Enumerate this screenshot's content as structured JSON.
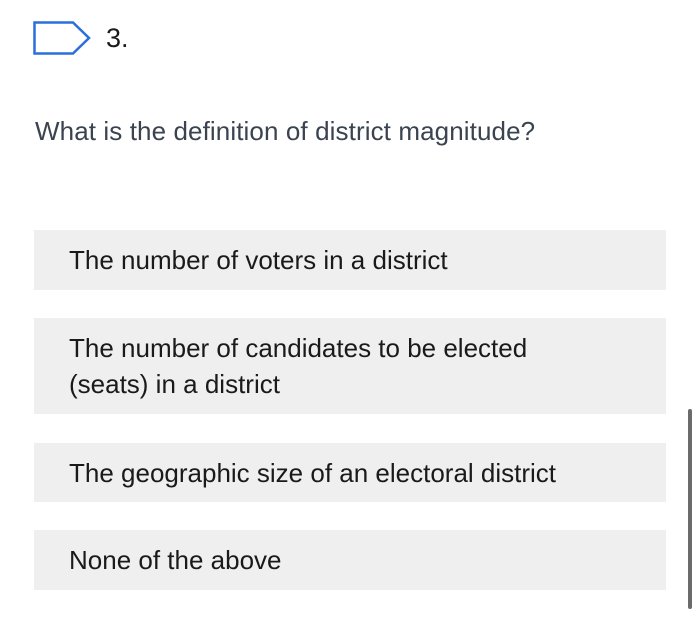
{
  "question": {
    "number": "3.",
    "text": "What is the definition of district magnitude?"
  },
  "options": [
    {
      "label": "The number of voters in a district"
    },
    {
      "label": "The number of candidates to be elected (seats) in a district"
    },
    {
      "label": "The geographic size of an electoral district"
    },
    {
      "label": "None of the above"
    }
  ],
  "icons": {
    "flag": "flag-icon"
  },
  "colors": {
    "accent": "#2a6fdb",
    "option_background": "#efefef",
    "question_text": "#3a4350"
  }
}
